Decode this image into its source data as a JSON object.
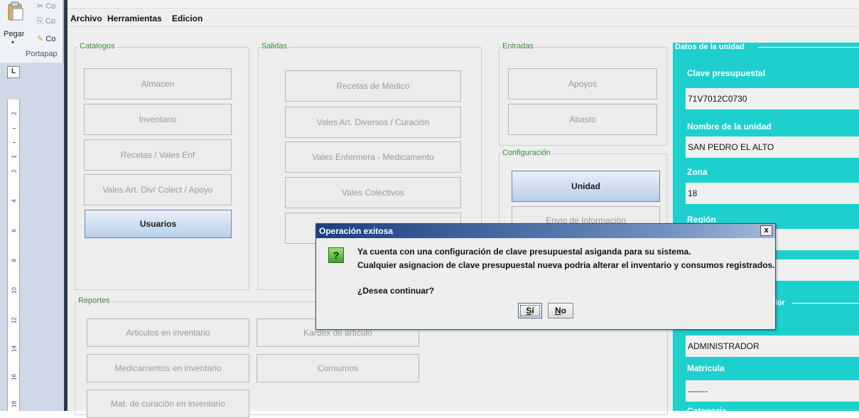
{
  "ribbon": {
    "paste_label": "Pegar",
    "cut_label": "Co",
    "copy_label": "Co",
    "format_label": "Co",
    "group_label": "Portapap",
    "paste_arrow": "▾"
  },
  "ruler": {
    "corner": "L",
    "numbers": [
      "2",
      "1",
      "2",
      "4",
      "6",
      "8",
      "10",
      "12",
      "14",
      "16",
      "18"
    ]
  },
  "menu": {
    "items": [
      "Archivo",
      "Herramientas",
      "Edicion"
    ]
  },
  "catalogos": {
    "title": "Catalogos",
    "buttons": [
      "Almacen",
      "Inventario",
      "Recetas / Vales Enf",
      "Vales Art. Div/ Colect / Apoyo",
      "Usuarios"
    ]
  },
  "salidas": {
    "title": "Salidas",
    "buttons": [
      "Recetas  de Médico",
      "Vales Art. Diversos / Curación",
      "Vales Enfermera - Medicamento",
      "Vales Colectivos",
      ""
    ]
  },
  "entradas": {
    "title": "Entradas",
    "buttons": [
      "Apoyos",
      "Abasto"
    ]
  },
  "configuracion": {
    "title": "Configuración",
    "buttons": [
      "Unidad",
      "Envio de Información"
    ]
  },
  "reportes": {
    "title": "Reportes",
    "buttons": [
      "Articulos en inventario",
      "Kardex de articulo",
      "Medicamentos en inventario",
      "Consumos",
      "Mat. de curación en inventario"
    ]
  },
  "datos": {
    "title": "Datos de la unidad",
    "clave_label": "Clave presupuestal",
    "clave_value": "71V7012C0730",
    "nombre_label": "Nombre de la unidad",
    "nombre_value": "SAN PEDRO EL ALTO",
    "zona_label": "Zona",
    "zona_value": "18",
    "region_label": "Región",
    "subpanel_title": "dor",
    "usuario_value": "ADMINISTRADOR",
    "matricula_label": "Matricula",
    "matricula_value": "-------",
    "categoria_label": "Categoria"
  },
  "dialog": {
    "title": "Operación exitosa",
    "close": "x",
    "icon": "?",
    "line1": "Ya cuenta con una configuración de clave presupuestal asiganda para su sistema.",
    "line2": "Cualquier asignacion de clave presupuestal nueva podria alterar el inventario y consumos registrados.",
    "question": "¿Desea continuar?",
    "yes_mnemonic": "S",
    "yes_rest": "í",
    "no_mnemonic": "N",
    "no_rest": "o"
  }
}
